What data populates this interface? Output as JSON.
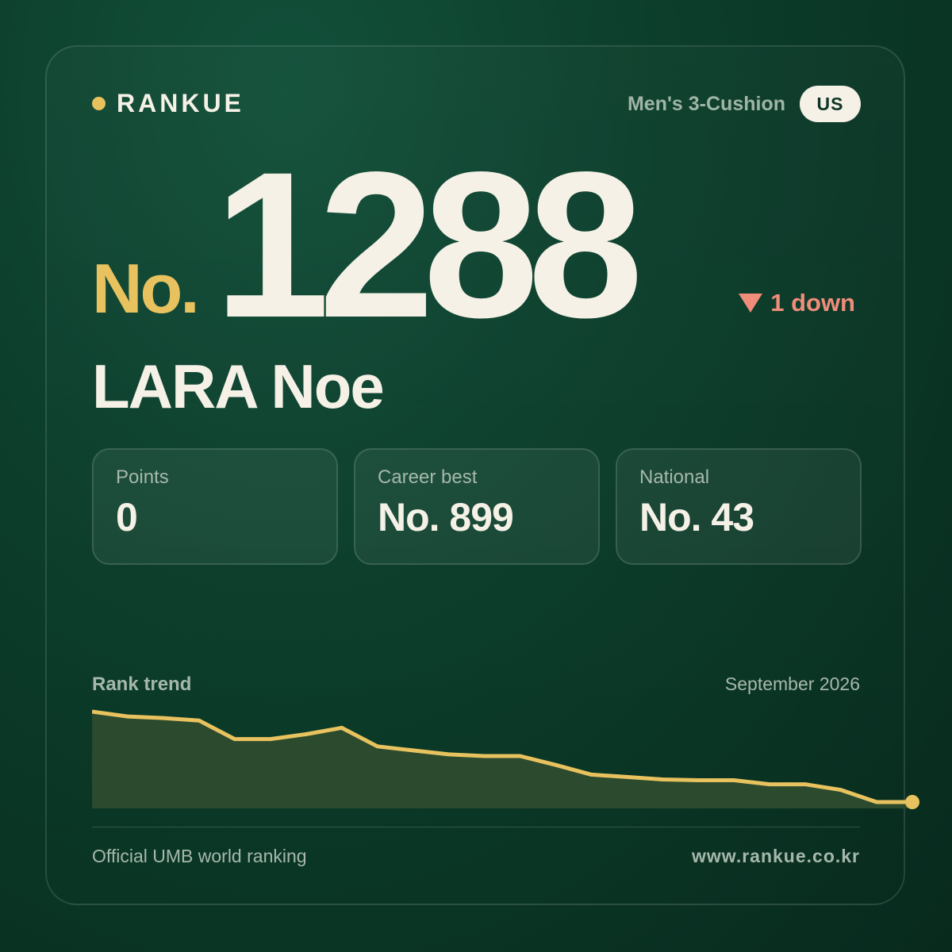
{
  "brand": {
    "name": "RANKUE",
    "accent": "#e8c25e"
  },
  "header": {
    "category": "Men's 3-Cushion",
    "country": "US"
  },
  "rank": {
    "prefix": "No.",
    "number": "1288",
    "change_label": "1 down",
    "change_direction": "down",
    "change_color": "#f08c7a"
  },
  "player": {
    "name": "LARA Noe"
  },
  "stats": [
    {
      "label": "Points",
      "value": "0"
    },
    {
      "label": "Career best",
      "value": "No. 899"
    },
    {
      "label": "National",
      "value": "No. 43"
    }
  ],
  "trend": {
    "title": "Rank trend",
    "date": "September 2026"
  },
  "chart_data": {
    "type": "area",
    "y_inverted": true,
    "points_relative_rank": [
      0,
      6,
      8,
      11,
      34,
      34,
      28,
      20,
      43,
      48,
      53,
      55,
      55,
      66,
      78,
      81,
      84,
      85,
      85,
      90,
      90,
      97,
      112,
      112
    ],
    "line_color": "#e8c25e",
    "fill_color": "#2b4a2e",
    "grid": false
  },
  "footer": {
    "source": "Official UMB world ranking",
    "url": "www.rankue.co.kr"
  }
}
